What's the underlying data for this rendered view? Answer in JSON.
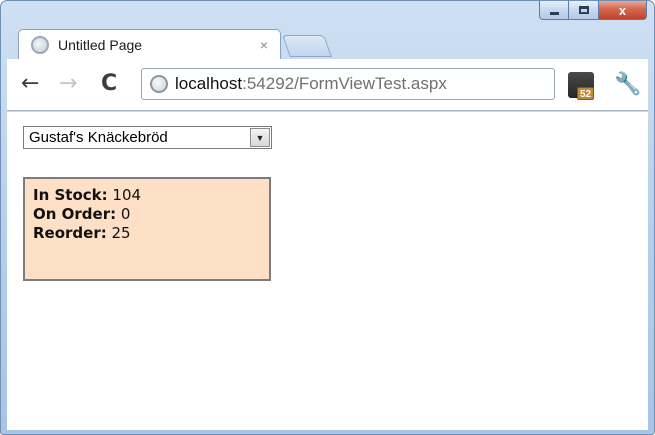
{
  "window": {
    "tab_title": "Untitled Page",
    "tab_close": "×",
    "controls": {
      "minimize": "",
      "maximize": "",
      "close": "x"
    }
  },
  "toolbar": {
    "back_icon": "←",
    "forward_icon": "→",
    "reload_icon": "C",
    "url_host": "localhost",
    "url_rest": ":54292/FormViewTest.aspx",
    "extension_badge": "52",
    "wrench_icon": "🔧"
  },
  "page": {
    "product_select": {
      "value": "Gustaf's Knäckebröd",
      "arrow": "▼"
    },
    "details": [
      {
        "label": "In Stock:",
        "value": "104"
      },
      {
        "label": "On Order:",
        "value": "0"
      },
      {
        "label": "Reorder:",
        "value": "25"
      }
    ]
  },
  "colors": {
    "details_background": "#fde0c6",
    "details_border": "#7c7c7c",
    "chrome_frame": "#b4cde9"
  }
}
